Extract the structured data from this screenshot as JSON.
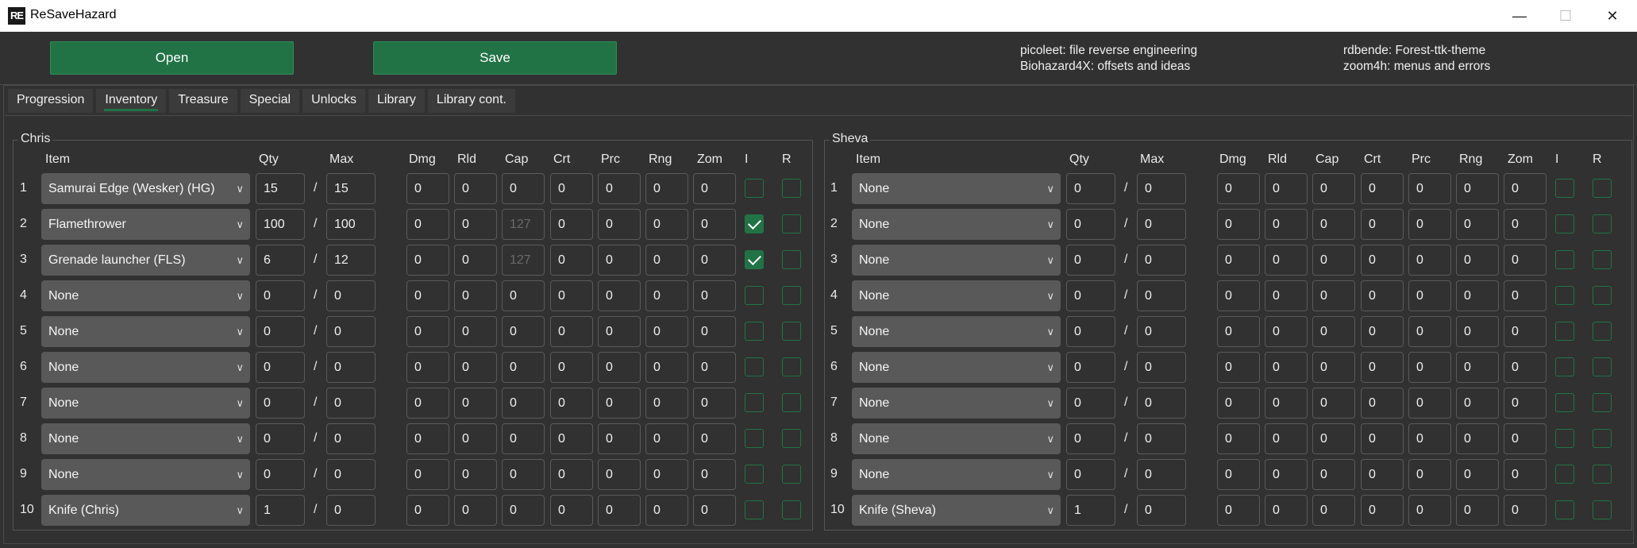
{
  "window": {
    "icon_text": "RE",
    "title": "ReSaveHazard",
    "minimize": "—",
    "maximize": "☐",
    "close": "✕"
  },
  "toolbar": {
    "open_label": "Open",
    "save_label": "Save"
  },
  "credits": [
    "picoleet: file reverse engineering",
    "Biohazard4X: offsets and ideas",
    "rdbende: Forest-ttk-theme",
    "zoom4h: menus and errors"
  ],
  "tabs": [
    "Progression",
    "Inventory",
    "Treasure",
    "Special",
    "Unlocks",
    "Library",
    "Library cont."
  ],
  "active_tab": "Inventory",
  "accent_color": "#217346",
  "columns": [
    "Item",
    "Qty",
    "Max",
    "Dmg",
    "Rld",
    "Cap",
    "Crt",
    "Prc",
    "Rng",
    "Zom",
    "I",
    "R"
  ],
  "slash": "/",
  "chris": {
    "title": "Chris",
    "rows": [
      {
        "n": "1",
        "item": "Samurai Edge (Wesker) (HG)",
        "qty": "15",
        "max": "15",
        "dmg": "0",
        "rld": "0",
        "cap": "0",
        "crt": "0",
        "prc": "0",
        "rng": "0",
        "zom": "0",
        "cap_disabled": false,
        "i": false,
        "r": false
      },
      {
        "n": "2",
        "item": "Flamethrower",
        "qty": "100",
        "max": "100",
        "dmg": "0",
        "rld": "0",
        "cap": "127",
        "crt": "0",
        "prc": "0",
        "rng": "0",
        "zom": "0",
        "cap_disabled": true,
        "i": true,
        "r": false
      },
      {
        "n": "3",
        "item": "Grenade launcher (FLS)",
        "qty": "6",
        "max": "12",
        "dmg": "0",
        "rld": "0",
        "cap": "127",
        "crt": "0",
        "prc": "0",
        "rng": "0",
        "zom": "0",
        "cap_disabled": true,
        "i": true,
        "r": false
      },
      {
        "n": "4",
        "item": "None",
        "qty": "0",
        "max": "0",
        "dmg": "0",
        "rld": "0",
        "cap": "0",
        "crt": "0",
        "prc": "0",
        "rng": "0",
        "zom": "0",
        "cap_disabled": false,
        "i": false,
        "r": false
      },
      {
        "n": "5",
        "item": "None",
        "qty": "0",
        "max": "0",
        "dmg": "0",
        "rld": "0",
        "cap": "0",
        "crt": "0",
        "prc": "0",
        "rng": "0",
        "zom": "0",
        "cap_disabled": false,
        "i": false,
        "r": false
      },
      {
        "n": "6",
        "item": "None",
        "qty": "0",
        "max": "0",
        "dmg": "0",
        "rld": "0",
        "cap": "0",
        "crt": "0",
        "prc": "0",
        "rng": "0",
        "zom": "0",
        "cap_disabled": false,
        "i": false,
        "r": false
      },
      {
        "n": "7",
        "item": "None",
        "qty": "0",
        "max": "0",
        "dmg": "0",
        "rld": "0",
        "cap": "0",
        "crt": "0",
        "prc": "0",
        "rng": "0",
        "zom": "0",
        "cap_disabled": false,
        "i": false,
        "r": false
      },
      {
        "n": "8",
        "item": "None",
        "qty": "0",
        "max": "0",
        "dmg": "0",
        "rld": "0",
        "cap": "0",
        "crt": "0",
        "prc": "0",
        "rng": "0",
        "zom": "0",
        "cap_disabled": false,
        "i": false,
        "r": false
      },
      {
        "n": "9",
        "item": "None",
        "qty": "0",
        "max": "0",
        "dmg": "0",
        "rld": "0",
        "cap": "0",
        "crt": "0",
        "prc": "0",
        "rng": "0",
        "zom": "0",
        "cap_disabled": false,
        "i": false,
        "r": false
      },
      {
        "n": "10",
        "item": "Knife (Chris)",
        "qty": "1",
        "max": "0",
        "dmg": "0",
        "rld": "0",
        "cap": "0",
        "crt": "0",
        "prc": "0",
        "rng": "0",
        "zom": "0",
        "cap_disabled": false,
        "i": false,
        "r": false
      }
    ]
  },
  "sheva": {
    "title": "Sheva",
    "rows": [
      {
        "n": "1",
        "item": "None",
        "qty": "0",
        "max": "0",
        "dmg": "0",
        "rld": "0",
        "cap": "0",
        "crt": "0",
        "prc": "0",
        "rng": "0",
        "zom": "0",
        "cap_disabled": false,
        "i": false,
        "r": false
      },
      {
        "n": "2",
        "item": "None",
        "qty": "0",
        "max": "0",
        "dmg": "0",
        "rld": "0",
        "cap": "0",
        "crt": "0",
        "prc": "0",
        "rng": "0",
        "zom": "0",
        "cap_disabled": false,
        "i": false,
        "r": false
      },
      {
        "n": "3",
        "item": "None",
        "qty": "0",
        "max": "0",
        "dmg": "0",
        "rld": "0",
        "cap": "0",
        "crt": "0",
        "prc": "0",
        "rng": "0",
        "zom": "0",
        "cap_disabled": false,
        "i": false,
        "r": false
      },
      {
        "n": "4",
        "item": "None",
        "qty": "0",
        "max": "0",
        "dmg": "0",
        "rld": "0",
        "cap": "0",
        "crt": "0",
        "prc": "0",
        "rng": "0",
        "zom": "0",
        "cap_disabled": false,
        "i": false,
        "r": false
      },
      {
        "n": "5",
        "item": "None",
        "qty": "0",
        "max": "0",
        "dmg": "0",
        "rld": "0",
        "cap": "0",
        "crt": "0",
        "prc": "0",
        "rng": "0",
        "zom": "0",
        "cap_disabled": false,
        "i": false,
        "r": false
      },
      {
        "n": "6",
        "item": "None",
        "qty": "0",
        "max": "0",
        "dmg": "0",
        "rld": "0",
        "cap": "0",
        "crt": "0",
        "prc": "0",
        "rng": "0",
        "zom": "0",
        "cap_disabled": false,
        "i": false,
        "r": false
      },
      {
        "n": "7",
        "item": "None",
        "qty": "0",
        "max": "0",
        "dmg": "0",
        "rld": "0",
        "cap": "0",
        "crt": "0",
        "prc": "0",
        "rng": "0",
        "zom": "0",
        "cap_disabled": false,
        "i": false,
        "r": false
      },
      {
        "n": "8",
        "item": "None",
        "qty": "0",
        "max": "0",
        "dmg": "0",
        "rld": "0",
        "cap": "0",
        "crt": "0",
        "prc": "0",
        "rng": "0",
        "zom": "0",
        "cap_disabled": false,
        "i": false,
        "r": false
      },
      {
        "n": "9",
        "item": "None",
        "qty": "0",
        "max": "0",
        "dmg": "0",
        "rld": "0",
        "cap": "0",
        "crt": "0",
        "prc": "0",
        "rng": "0",
        "zom": "0",
        "cap_disabled": false,
        "i": false,
        "r": false
      },
      {
        "n": "10",
        "item": "Knife (Sheva)",
        "qty": "1",
        "max": "0",
        "dmg": "0",
        "rld": "0",
        "cap": "0",
        "crt": "0",
        "prc": "0",
        "rng": "0",
        "zom": "0",
        "cap_disabled": false,
        "i": false,
        "r": false
      }
    ]
  }
}
